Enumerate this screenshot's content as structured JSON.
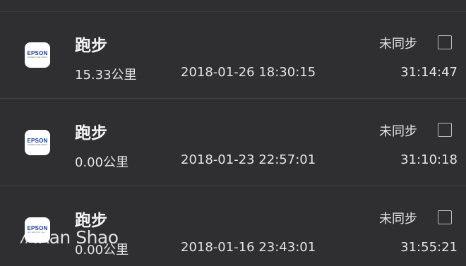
{
  "records": [
    {
      "app_icon": "epson-app-icon",
      "app_brand": "EPSON",
      "app_tagline": "EXCEED YOUR VISION",
      "activity": "跑步",
      "distance": "15.33公里",
      "datetime": "2018-01-26 18:30:15",
      "duration": "31:14:47",
      "sync_status": "未同步",
      "checked": false
    },
    {
      "app_icon": "epson-app-icon",
      "app_brand": "EPSON",
      "app_tagline": "EXCEED YOUR VISION",
      "activity": "跑步",
      "distance": "0.00公里",
      "datetime": "2018-01-23 22:57:01",
      "duration": "31:10:18",
      "sync_status": "未同步",
      "checked": false
    },
    {
      "app_icon": "epson-app-icon",
      "app_brand": "EPSON",
      "app_tagline": "EXCEED YOUR VISION",
      "activity": "跑步",
      "distance": "0.00公里",
      "datetime": "2018-01-16 23:43:01",
      "duration": "31:55:21",
      "sync_status": "未同步",
      "checked": false
    }
  ],
  "watermark": {
    "text": "iRan Shao"
  },
  "colors": {
    "background": "#2f2f31",
    "divider": "#404043",
    "text_primary": "#f5f5f5",
    "text_secondary": "#e4e4e4",
    "checkbox_border": "#bdbdbd",
    "brand_blue": "#1d3c8e"
  }
}
